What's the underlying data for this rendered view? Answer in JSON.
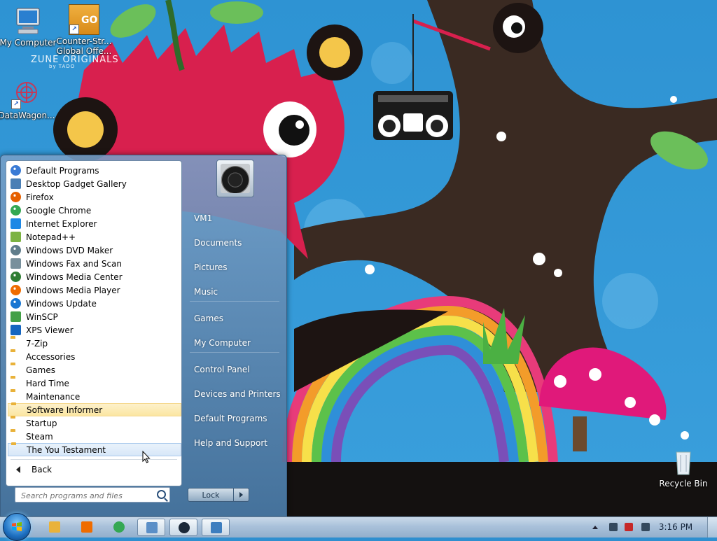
{
  "desktop": {
    "icons": [
      {
        "label": "My Computer"
      },
      {
        "label": "Counter-Str... Global Offe..."
      },
      {
        "label": "DataWagon..."
      },
      {
        "label": "Recycle Bin"
      }
    ],
    "wallpaper_text": "ZUNE ORIGINALS",
    "wallpaper_subtext": "by TADO",
    "go_tile_text": "GO"
  },
  "start_menu": {
    "programs": [
      {
        "label": "Default Programs",
        "icon": "default-programs-icon",
        "color": "#3a7bd5"
      },
      {
        "label": "Desktop Gadget Gallery",
        "icon": "gadget-gallery-icon",
        "color": "#4a7fb5"
      },
      {
        "label": "Firefox",
        "icon": "firefox-icon",
        "color": "#e66000"
      },
      {
        "label": "Google Chrome",
        "icon": "chrome-icon",
        "color": "#34a853"
      },
      {
        "label": "Internet Explorer",
        "icon": "internet-explorer-icon",
        "color": "#1e88e5"
      },
      {
        "label": "Notepad++",
        "icon": "notepadpp-icon",
        "color": "#7cb342"
      },
      {
        "label": "Windows DVD Maker",
        "icon": "dvd-maker-icon",
        "color": "#607d8b"
      },
      {
        "label": "Windows Fax and Scan",
        "icon": "fax-scan-icon",
        "color": "#78909c"
      },
      {
        "label": "Windows Media Center",
        "icon": "media-center-icon",
        "color": "#2e7d32"
      },
      {
        "label": "Windows Media Player",
        "icon": "media-player-icon",
        "color": "#ef6c00"
      },
      {
        "label": "Windows Update",
        "icon": "windows-update-icon",
        "color": "#1976d2"
      },
      {
        "label": "WinSCP",
        "icon": "winscp-icon",
        "color": "#43a047"
      },
      {
        "label": "XPS Viewer",
        "icon": "xps-viewer-icon",
        "color": "#1565c0"
      },
      {
        "label": "7-Zip",
        "icon": "folder-icon",
        "color": "#e9b23a"
      },
      {
        "label": "Accessories",
        "icon": "folder-icon",
        "color": "#e9b23a"
      },
      {
        "label": "Games",
        "icon": "folder-icon",
        "color": "#e9b23a"
      },
      {
        "label": "Hard Time",
        "icon": "folder-icon",
        "color": "#e9b23a"
      },
      {
        "label": "Maintenance",
        "icon": "folder-icon",
        "color": "#e9b23a"
      },
      {
        "label": "Software Informer",
        "icon": "folder-icon",
        "color": "#e9b23a"
      },
      {
        "label": "Startup",
        "icon": "folder-icon",
        "color": "#e9b23a"
      },
      {
        "label": "Steam",
        "icon": "folder-icon",
        "color": "#e9b23a"
      },
      {
        "label": "The You Testament",
        "icon": "folder-icon",
        "color": "#e9b23a"
      }
    ],
    "back_label": "Back",
    "search_placeholder": "Search programs and files",
    "right_items": [
      {
        "label": "VM1"
      },
      {
        "label": "Documents"
      },
      {
        "label": "Pictures"
      },
      {
        "label": "Music"
      },
      {
        "label": "Games"
      },
      {
        "label": "My Computer"
      },
      {
        "label": "Control Panel"
      },
      {
        "label": "Devices and Printers"
      },
      {
        "label": "Default Programs"
      },
      {
        "label": "Help and Support"
      }
    ],
    "lock_label": "Lock"
  },
  "taskbar": {
    "pinned": [
      {
        "icon": "explorer-folder-icon"
      },
      {
        "icon": "media-player-icon"
      },
      {
        "icon": "chrome-icon"
      },
      {
        "icon": "control-panel-icon"
      },
      {
        "icon": "steam-icon"
      },
      {
        "icon": "remote-desktop-icon"
      }
    ],
    "tray_icons": [
      "show-hidden-icons-icon",
      "network-icon",
      "action-center-icon",
      "volume-icon"
    ],
    "clock": "3:16 PM"
  }
}
